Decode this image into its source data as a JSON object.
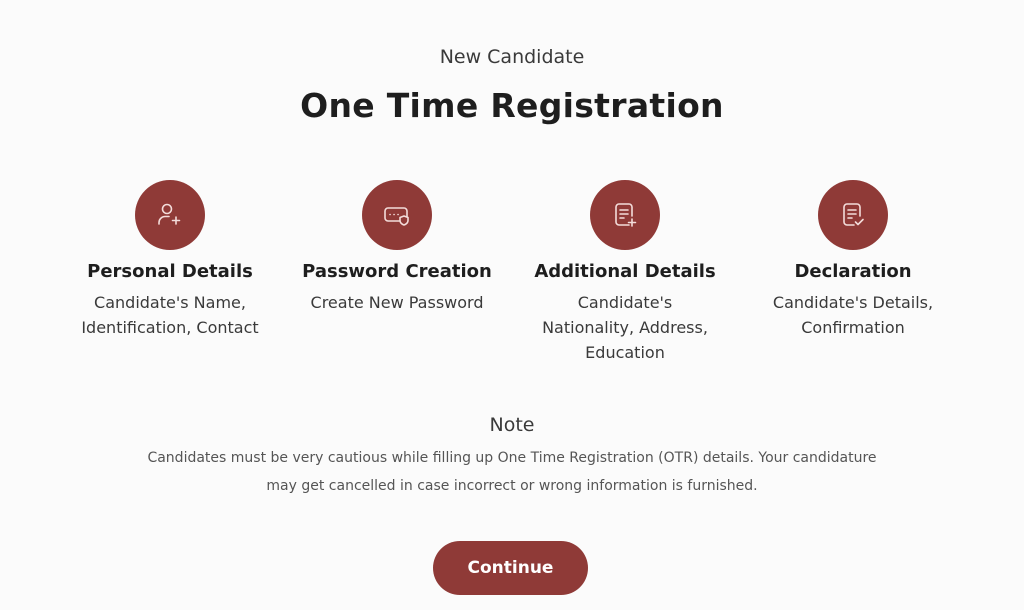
{
  "header": {
    "subtitle": "New Candidate",
    "title": "One Time Registration"
  },
  "steps": [
    {
      "icon": "user-plus-icon",
      "heading": "Personal Details",
      "desc_lines": [
        "Candidate's Name,",
        "Identification, Contact"
      ]
    },
    {
      "icon": "password-shield-icon",
      "heading": "Password Creation",
      "desc_lines": [
        "Create New Password"
      ]
    },
    {
      "icon": "document-add-icon",
      "heading": "Additional Details",
      "desc_lines": [
        "Candidate's",
        "Nationality, Address,",
        "Education"
      ]
    },
    {
      "icon": "document-check-icon",
      "heading": "Declaration",
      "desc_lines": [
        "Candidate's Details,",
        "Confirmation"
      ]
    }
  ],
  "note": {
    "title": "Note",
    "lines": [
      "Candidates must be very cautious while filling up One Time Registration (OTR) details. Your candidature",
      "may get cancelled in case incorrect or wrong information is furnished."
    ]
  },
  "actions": {
    "continue_label": "Continue"
  },
  "colors": {
    "accent": "#8f3a37",
    "background": "#fbfbfb"
  }
}
